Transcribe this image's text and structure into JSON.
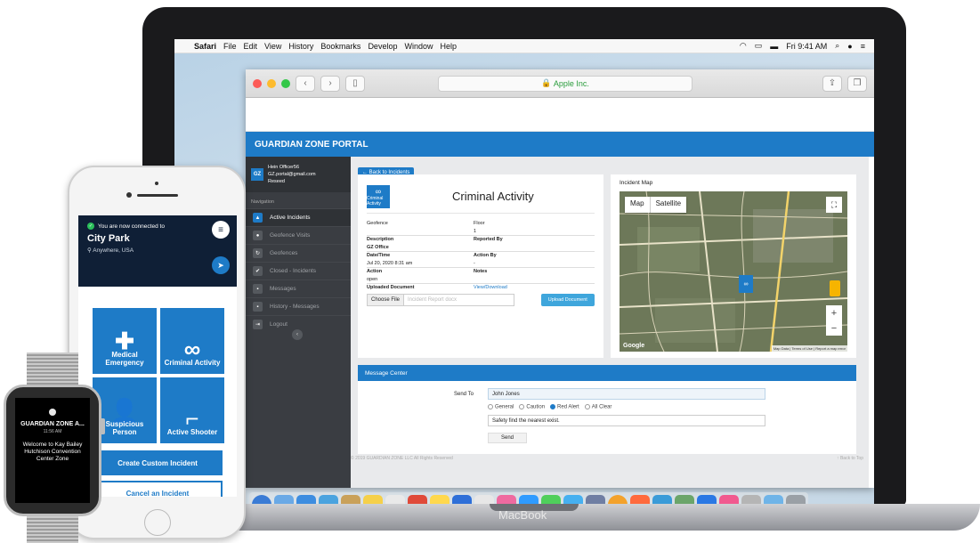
{
  "menubar": {
    "apple": "",
    "items": [
      "Safari",
      "File",
      "Edit",
      "View",
      "History",
      "Bookmarks",
      "Develop",
      "Window",
      "Help"
    ],
    "clock": "Fri 9:41 AM"
  },
  "browser": {
    "url": "Apple Inc."
  },
  "portal": {
    "title": "GUARDIAN ZONE PORTAL",
    "user": {
      "avatar": "GZ",
      "name": "Hein Officer56",
      "email": "GZ.portal@gmail.com",
      "role": "Reseed"
    },
    "nav_label": "Navigation",
    "nav_items": [
      {
        "label": "Active Incidents",
        "icon": "alert-icon",
        "glyph": "▲"
      },
      {
        "label": "Geofence Visits",
        "icon": "person-icon",
        "glyph": "●"
      },
      {
        "label": "Geofences",
        "icon": "refresh-icon",
        "glyph": "↻"
      },
      {
        "label": "Closed - Incidents",
        "icon": "check-icon",
        "glyph": "✔"
      },
      {
        "label": "Messages",
        "icon": "chat-icon",
        "glyph": "▪"
      },
      {
        "label": "History - Messages",
        "icon": "chat-icon",
        "glyph": "▪"
      },
      {
        "label": "Logout",
        "icon": "logout-icon",
        "glyph": "⇥"
      }
    ],
    "back_label": "← Back to Incidents",
    "incident": {
      "title": "Criminal Activity",
      "logo_text": "Criminal Activity",
      "rows": [
        {
          "c1": "Geofence",
          "c2": "Floor"
        },
        {
          "c1": "",
          "c2": "1"
        },
        {
          "c1": "Description",
          "c2": "Reported By"
        },
        {
          "c1": "GZ Office",
          "c2": ""
        },
        {
          "c1": "Date/Time",
          "c2": "Action By"
        },
        {
          "c1": "Jul 20, 2020 8:31 am",
          "c2": "-"
        },
        {
          "c1": "Action",
          "c2": "Notes"
        },
        {
          "c1": "open",
          "c2": ""
        }
      ],
      "uploaded_label": "Uploaded Document",
      "view_link": "View/Download",
      "choose_file": "Choose File",
      "file_placeholder": "Incident Report docx",
      "upload_btn": "Upload Document"
    },
    "map": {
      "title": "Incident Map",
      "map_btn": "Map",
      "satellite_btn": "Satellite",
      "google": "Google",
      "attribution": "Map Data | Terms of Use | Report a map error"
    },
    "message_center": {
      "title": "Message Center",
      "send_to_label": "Send To",
      "send_to_value": "John Jones",
      "radios": [
        {
          "label": "General",
          "selected": false
        },
        {
          "label": "Caution",
          "selected": false
        },
        {
          "label": "Red Alert",
          "selected": true
        },
        {
          "label": "All Clear",
          "selected": false
        }
      ],
      "message": "Safety find the nearest exist.",
      "send_btn": "Send"
    },
    "footer_left": "© 2019 GUARDIAN ZONE LLC All Rights Reserved",
    "footer_right": "↑ Back to Top"
  },
  "dock_colors": [
    "#3a7bd5",
    "#6aa9e6",
    "#3d8de0",
    "#4aa3df",
    "#c9a15a",
    "#f5d04a",
    "#e9e9e9",
    "#e04a3a",
    "#ffd84d",
    "#2e6fd8",
    "#e7e7e7",
    "#ef6aa0",
    "#2f9bff",
    "#4fcf5b",
    "#46b0f0",
    "#6f7ea3",
    "#f3a22c",
    "#ff6a3d",
    "#3a9bd8",
    "#6ba56a",
    "#2a78e4",
    "#f15a8f",
    "#b5b5b5",
    "#6fb4e8",
    "#9aa0a6"
  ],
  "iphone": {
    "connected": "You are now connected to",
    "place": "City Park",
    "location": "Anywhere, USA",
    "tiles": [
      {
        "label": "Medical Emergency",
        "glyph": "✚"
      },
      {
        "label": "Criminal Activity",
        "glyph": "∞"
      },
      {
        "label": "Suspicious Person",
        "glyph": "👤"
      },
      {
        "label": "Active Shooter",
        "glyph": "⌐"
      }
    ],
    "create_custom": "Create Custom Incident",
    "cancel": "Cancel an Incident"
  },
  "watch": {
    "title": "GUARDIAN ZONE A...",
    "time": "11:56 AM",
    "message": "Welcome to Kay Bailey Hutchison Convention Center Zone"
  },
  "macbook_label": "MacBook"
}
